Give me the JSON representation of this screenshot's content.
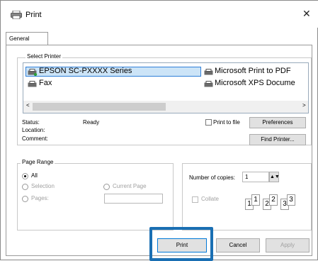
{
  "window": {
    "title": "Print",
    "close_glyph": "✕",
    "icon": "printer-icon"
  },
  "tabs": [
    {
      "label": "General"
    }
  ],
  "select_printer": {
    "label": "Select Printer",
    "printers": [
      {
        "name": "EPSON SC-PXXXX Series",
        "selected": true
      },
      {
        "name": "Microsoft Print to PDF"
      },
      {
        "name": "Fax"
      },
      {
        "name": "Microsoft XPS Docume"
      }
    ],
    "scroll_left": "<",
    "scroll_right": ">"
  },
  "status": {
    "status_label": "Status:",
    "status_value": "Ready",
    "location_label": "Location:",
    "comment_label": "Comment:",
    "print_to_file_label": "Print to file",
    "preferences_label": "Preferences",
    "find_printer_label": "Find Printer..."
  },
  "page_range": {
    "label": "Page Range",
    "all_label": "All",
    "selection_label": "Selection",
    "current_page_label": "Current Page",
    "pages_label": "Pages:",
    "pages_value": ""
  },
  "copies": {
    "number_label": "Number of copies:",
    "number_value": "1",
    "collate_label": "Collate",
    "pages": [
      "1",
      "1",
      "2",
      "2",
      "3",
      "3"
    ]
  },
  "footer": {
    "print_label": "Print",
    "cancel_label": "Cancel",
    "apply_label": "Apply"
  }
}
